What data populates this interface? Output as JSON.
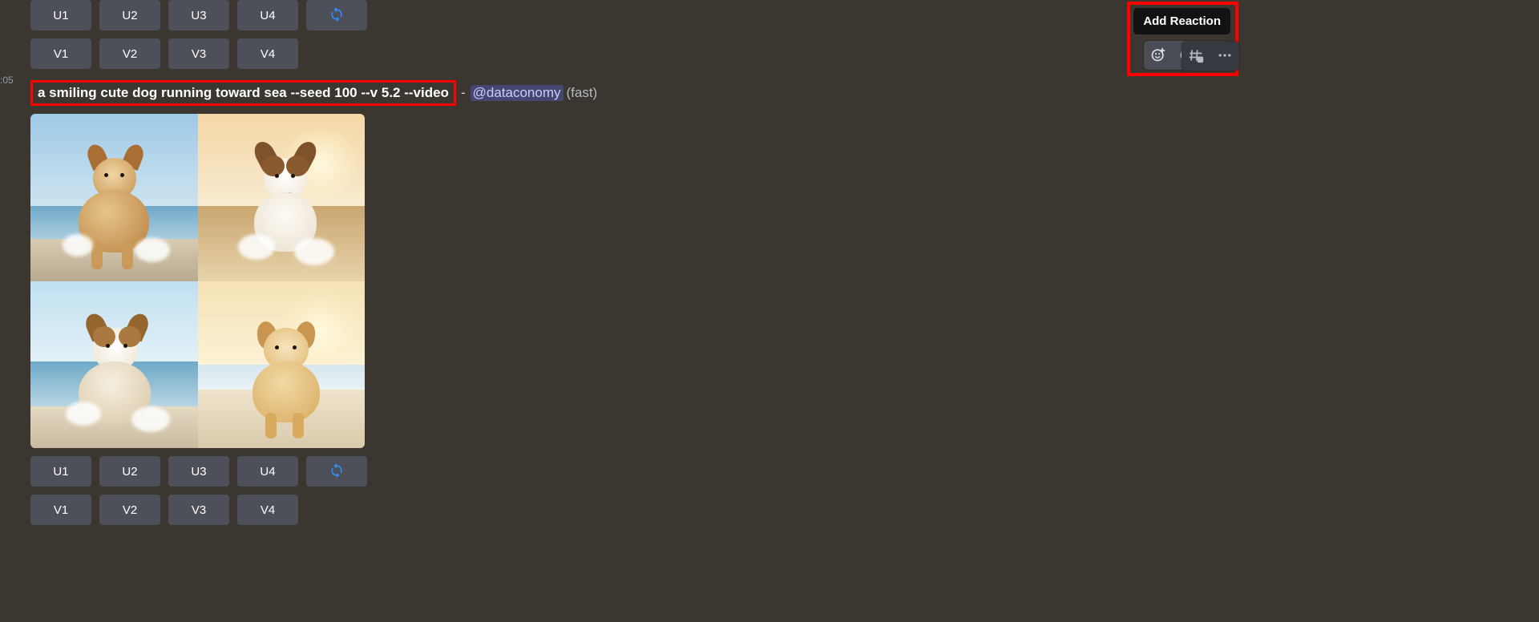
{
  "timestamp": ":05",
  "buttons_top": {
    "upscale": [
      "U1",
      "U2",
      "U3",
      "U4"
    ],
    "variations": [
      "V1",
      "V2",
      "V3",
      "V4"
    ]
  },
  "message": {
    "prompt": "a smiling cute dog running toward sea --seed 100 --v 5.2 --video",
    "separator": "-",
    "mention": "@dataconomy",
    "mode": "(fast)"
  },
  "buttons_bottom": {
    "upscale": [
      "U1",
      "U2",
      "U3",
      "U4"
    ],
    "variations": [
      "V1",
      "V2",
      "V3",
      "V4"
    ]
  },
  "hover": {
    "tooltip": "Add Reaction",
    "icons": [
      "add-reaction-icon",
      "super-reaction-icon",
      "reply-icon"
    ],
    "secondary_icons": [
      "create-thread-icon",
      "more-icon"
    ]
  }
}
